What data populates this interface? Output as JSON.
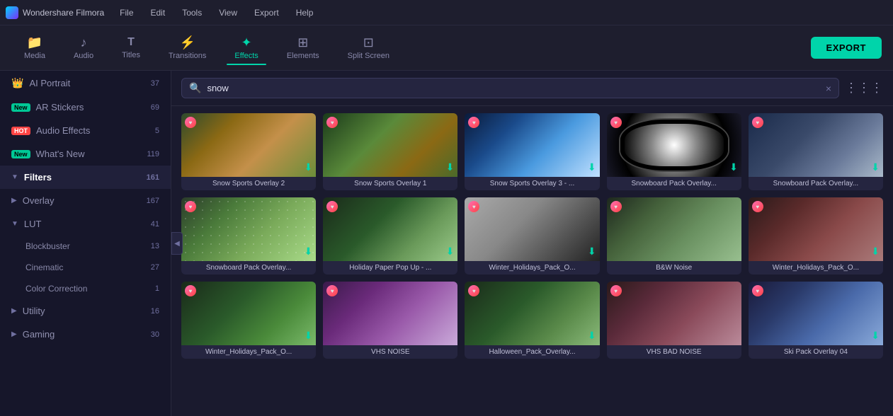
{
  "app": {
    "name": "Wondershare Filmora",
    "logo_alt": "Filmora Logo"
  },
  "menu": {
    "items": [
      "File",
      "Edit",
      "Tools",
      "View",
      "Export",
      "Help"
    ]
  },
  "toolbar": {
    "items": [
      {
        "id": "media",
        "label": "Media",
        "icon": "📁"
      },
      {
        "id": "audio",
        "label": "Audio",
        "icon": "🎵"
      },
      {
        "id": "titles",
        "label": "Titles",
        "icon": "T"
      },
      {
        "id": "transitions",
        "label": "Transitions",
        "icon": "⚡"
      },
      {
        "id": "effects",
        "label": "Effects",
        "icon": "✦"
      },
      {
        "id": "elements",
        "label": "Elements",
        "icon": "⊞"
      },
      {
        "id": "split_screen",
        "label": "Split Screen",
        "icon": "⊡"
      }
    ],
    "active": "effects",
    "export_label": "EXPORT"
  },
  "sidebar": {
    "items": [
      {
        "id": "ai_portrait",
        "label": "AI Portrait",
        "badge": "37",
        "badge_type": "ai",
        "icon": "👑",
        "level": 0
      },
      {
        "id": "ar_stickers",
        "label": "AR Stickers",
        "badge": "69",
        "badge_type": "new",
        "level": 0
      },
      {
        "id": "audio_effects",
        "label": "Audio Effects",
        "badge": "5",
        "badge_type": "hot",
        "level": 0
      },
      {
        "id": "whats_new",
        "label": "What's New",
        "badge": "119",
        "badge_type": "new",
        "level": 0
      },
      {
        "id": "filters",
        "label": "Filters",
        "badge": "161",
        "badge_type": "none",
        "expanded": true,
        "level": 0
      },
      {
        "id": "overlay",
        "label": "Overlay",
        "badge": "167",
        "badge_type": "none",
        "level": 0
      },
      {
        "id": "lut",
        "label": "LUT",
        "badge": "41",
        "badge_type": "none",
        "expanded": true,
        "level": 0
      },
      {
        "id": "blockbuster",
        "label": "Blockbuster",
        "badge": "13",
        "badge_type": "none",
        "level": 1
      },
      {
        "id": "cinematic",
        "label": "Cinematic",
        "badge": "27",
        "badge_type": "none",
        "level": 1
      },
      {
        "id": "color_correction",
        "label": "Color Correction",
        "badge": "1",
        "badge_type": "none",
        "level": 1
      },
      {
        "id": "utility",
        "label": "Utility",
        "badge": "16",
        "badge_type": "none",
        "level": 0
      },
      {
        "id": "gaming",
        "label": "Gaming",
        "badge": "30",
        "badge_type": "none",
        "level": 0
      }
    ]
  },
  "search": {
    "placeholder": "snow",
    "value": "snow",
    "clear_label": "×"
  },
  "effects": [
    {
      "id": 1,
      "name": "Snow Sports Overlay 2",
      "thumb": "thumb-1",
      "has_download": true,
      "has_heart": true
    },
    {
      "id": 2,
      "name": "Snow Sports Overlay 1",
      "thumb": "thumb-2",
      "has_download": true,
      "has_heart": true
    },
    {
      "id": 3,
      "name": "Snow Sports Overlay 3 - ...",
      "thumb": "thumb-3",
      "has_download": true,
      "has_heart": true
    },
    {
      "id": 4,
      "name": "Snowboard Pack Overlay...",
      "thumb": "thumb-4",
      "has_download": true,
      "has_heart": true,
      "goggles": true
    },
    {
      "id": 5,
      "name": "Snowboard Pack Overlay...",
      "thumb": "thumb-5",
      "has_download": true,
      "has_heart": true
    },
    {
      "id": 6,
      "name": "Snowboard Pack Overlay...",
      "thumb": "thumb-6",
      "has_download": true,
      "has_heart": true,
      "snow": true
    },
    {
      "id": 7,
      "name": "Holiday Paper Pop Up - ...",
      "thumb": "thumb-7",
      "has_download": true,
      "has_heart": true
    },
    {
      "id": 8,
      "name": "Winter_Holidays_Pack_O...",
      "thumb": "thumb-8",
      "has_download": true,
      "has_heart": true
    },
    {
      "id": 9,
      "name": "B&W Noise",
      "thumb": "thumb-9",
      "has_download": false,
      "has_heart": true,
      "bw": true
    },
    {
      "id": 10,
      "name": "Winter_Holidays_Pack_O...",
      "thumb": "thumb-10",
      "has_download": true,
      "has_heart": true
    },
    {
      "id": 11,
      "name": "Winter_Holidays_Pack_O...",
      "thumb": "thumb-11",
      "has_download": true,
      "has_heart": true
    },
    {
      "id": 12,
      "name": "VHS NOISE",
      "thumb": "thumb-12",
      "has_download": false,
      "has_heart": true
    },
    {
      "id": 13,
      "name": "Halloween_Pack_Overlay...",
      "thumb": "thumb-13",
      "has_download": true,
      "has_heart": true
    },
    {
      "id": 14,
      "name": "VHS BAD NOISE",
      "thumb": "thumb-14",
      "has_download": false,
      "has_heart": true
    },
    {
      "id": 15,
      "name": "Ski Pack Overlay 04",
      "thumb": "thumb-15",
      "has_download": true,
      "has_heart": true
    }
  ],
  "colors": {
    "accent": "#00d4aa",
    "active_tab_underline": "#00d4aa",
    "export_bg": "#00d4aa",
    "heart": "#ff4466",
    "download": "#00d4aa"
  }
}
